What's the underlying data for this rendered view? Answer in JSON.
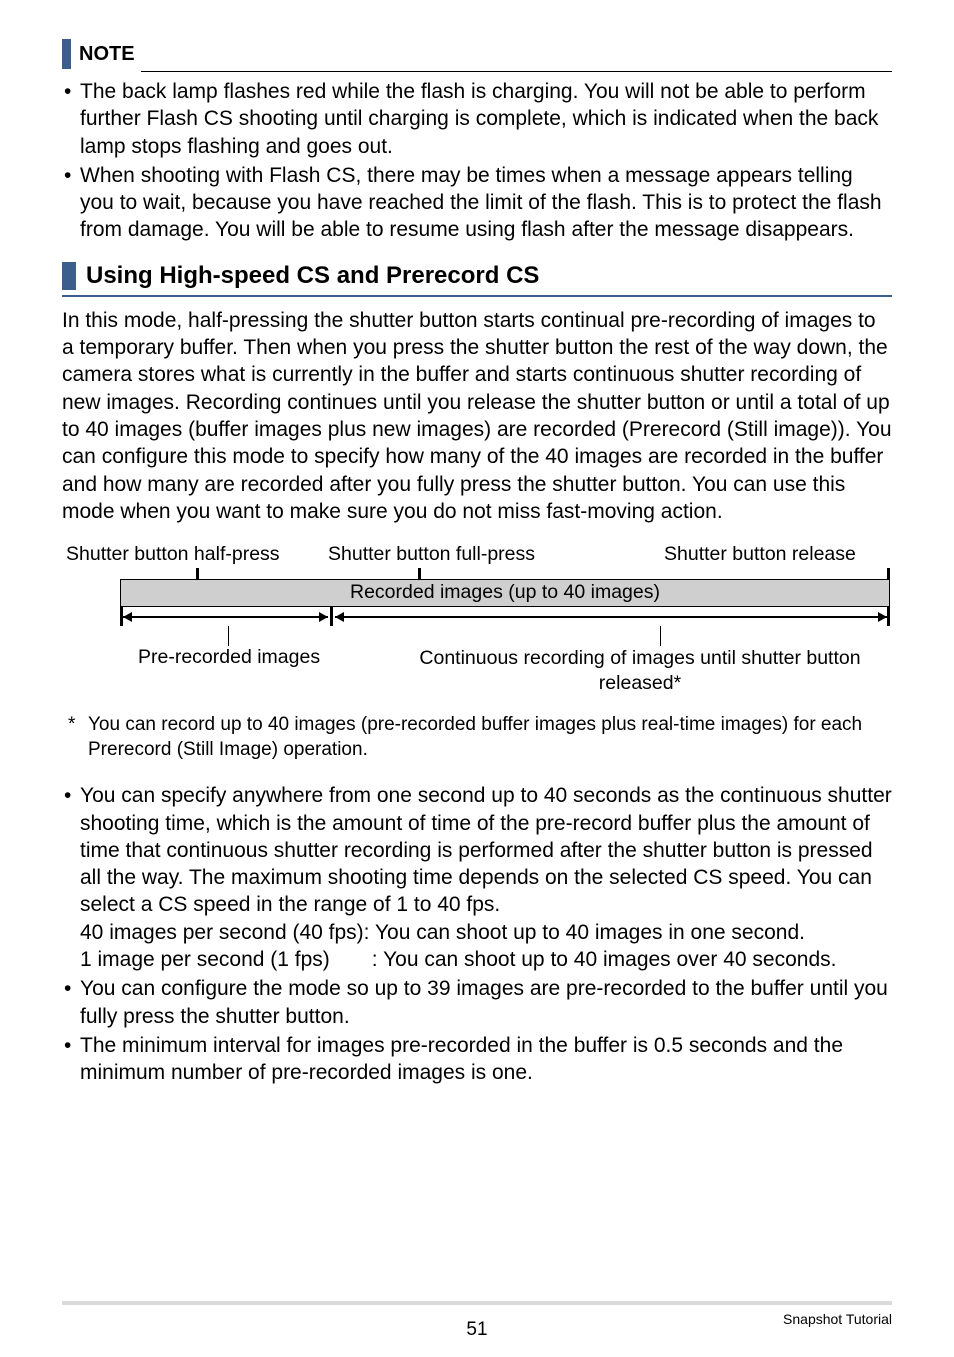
{
  "note": {
    "label": "NOTE",
    "bullet1": "The back lamp flashes red while the flash is charging. You will not be able to perform further Flash CS shooting until charging is complete, which is indicated when the back lamp stops flashing and goes out.",
    "bullet2": "When shooting with Flash CS, there may be times when a message appears telling you to wait, because you have reached the limit of the flash. This is to protect the flash from damage. You will be able to resume using flash after the message disappears."
  },
  "section": {
    "title": "Using High-speed CS and Prerecord CS",
    "body": "In this mode, half-pressing the shutter button starts continual pre-recording of images to a temporary buffer. Then when you press the shutter button the rest of the way down, the camera stores what is currently in the buffer and starts continuous shutter recording of new images. Recording continues until you release the shutter button or until a total of up to 40 images (buffer images plus new images) are recorded (Prerecord (Still image)). You can configure this mode to specify how many of the 40 images are recorded in the buffer and how many are recorded after you fully press the shutter button. You can use this mode when you want to make sure you do not miss fast-moving action."
  },
  "diagram": {
    "half_press": "Shutter button half-press",
    "full_press": "Shutter button full-press",
    "release": "Shutter button release",
    "recorded_bar": "Recorded images (up to 40 images)",
    "pre_recorded": "Pre-recorded images",
    "continuous": "Continuous recording of images until shutter button released*"
  },
  "footnote": {
    "star": "*",
    "text": "You can record up to 40 images (pre-recorded buffer images plus real-time images) for each Prerecord (Still Image) operation."
  },
  "bullets2": {
    "b1": "You can specify anywhere from one second up to 40 seconds as the continuous shutter shooting time, which is the amount of time of the pre-record buffer plus the amount of time that continuous shutter recording is performed after the shutter button is pressed all the way. The maximum shooting time depends on the selected CS speed. You can select a CS speed in the range of 1 to 40 fps.\n40 images per second (40 fps): You can shoot up to 40 images in one second.\n1 image per second (1 fps)  : You can shoot up to 40 images over 40 seconds.",
    "b2": "You can configure the mode so up to 39 images are pre-recorded to the buffer until you fully press the shutter button.",
    "b3": "The minimum interval for images pre-recorded in the buffer is 0.5 seconds and the minimum number of pre-recorded images is one."
  },
  "footer": {
    "page": "51",
    "section_name": "Snapshot Tutorial"
  }
}
